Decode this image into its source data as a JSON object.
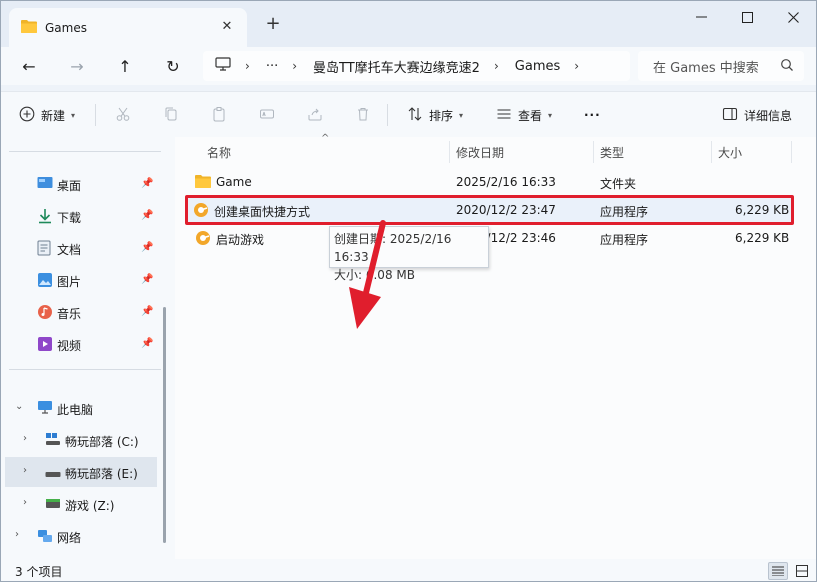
{
  "window": {
    "tab_title": "Games",
    "new_tab": "+",
    "controls": {
      "minimize": "—",
      "maximize": "☐",
      "close": "✕"
    }
  },
  "nav": {
    "back": "←",
    "forward": "→",
    "up": "↑",
    "refresh": "↻",
    "breadcrumb": [
      "曼岛TT摩托车大赛边缘竞速2",
      "Games"
    ],
    "overflow": "···",
    "search_placeholder": "在 Games 中搜索"
  },
  "toolbar": {
    "new_label": "新建",
    "sort_label": "排序",
    "view_label": "查看",
    "more": "···",
    "details_label": "详细信息"
  },
  "sidebar": {
    "quick": [
      {
        "label": "桌面",
        "icon": "desktop-icon"
      },
      {
        "label": "下载",
        "icon": "download-icon"
      },
      {
        "label": "文档",
        "icon": "document-icon"
      },
      {
        "label": "图片",
        "icon": "pictures-icon"
      },
      {
        "label": "音乐",
        "icon": "music-icon"
      },
      {
        "label": "视频",
        "icon": "video-icon"
      }
    ],
    "this_pc": "此电脑",
    "drives": [
      {
        "label": "畅玩部落 (C:)",
        "icon": "drive-c-icon"
      },
      {
        "label": "畅玩部落 (E:)",
        "icon": "drive-e-icon"
      },
      {
        "label": "游戏 (Z:)",
        "icon": "drive-z-icon"
      }
    ],
    "network": "网络"
  },
  "columns": {
    "name": "名称",
    "modified": "修改日期",
    "type": "类型",
    "size": "大小"
  },
  "files": [
    {
      "name": "Game",
      "modified": "2025/2/16 16:33",
      "type": "文件夹",
      "size": ""
    },
    {
      "name": "创建桌面快捷方式",
      "modified": "2020/12/2 23:47",
      "type": "应用程序",
      "size": "6,229 KB"
    },
    {
      "name": "启动游戏",
      "modified": "2020/12/2 23:46",
      "type": "应用程序",
      "size": "6,229 KB"
    }
  ],
  "tooltip": {
    "created": "创建日期: 2025/2/16 16:33",
    "size": "大小: 6.08 MB"
  },
  "status": {
    "count": "3 个项目"
  },
  "colors": {
    "highlight": "#e01e2d",
    "accent": "#0067c0"
  }
}
